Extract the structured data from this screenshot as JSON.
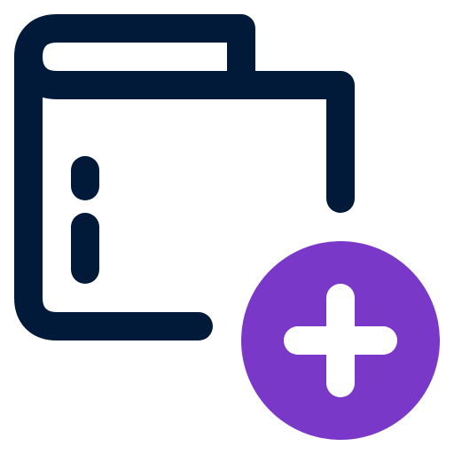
{
  "icon": {
    "name": "add-wallet-icon",
    "colors": {
      "outline": "#021A3A",
      "accent": "#7A38C8",
      "accent_symbol": "#FFFFFF",
      "background": "#FFFFFF"
    }
  }
}
